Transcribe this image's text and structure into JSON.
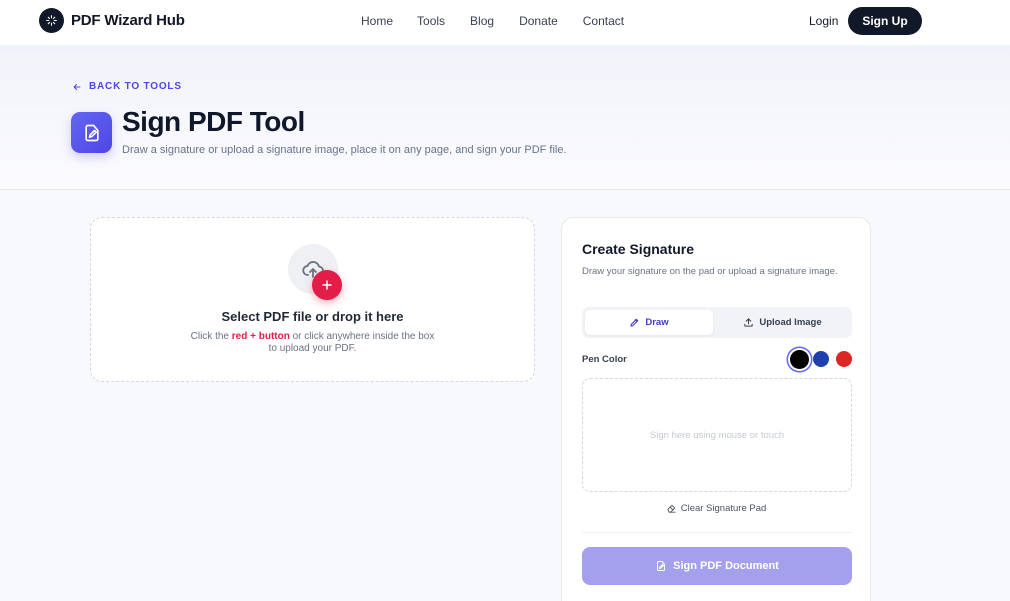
{
  "header": {
    "brand_name": "PDF Wizard Hub",
    "nav": [
      "Home",
      "Tools",
      "Blog",
      "Donate",
      "Contact"
    ],
    "login": "Login",
    "signup": "Sign Up"
  },
  "hero": {
    "back_label": "BACK TO TOOLS",
    "title": "Sign PDF Tool",
    "subtitle": "Draw a signature or upload a signature image, place it on any page, and sign your PDF file."
  },
  "dropzone": {
    "title": "Select PDF file or drop it here",
    "help_prefix": "Click the ",
    "help_highlight": "red + button",
    "help_suffix": " or click anywhere inside the box",
    "help_line2": "to upload your PDF.",
    "plus_symbol": "+"
  },
  "signature_panel": {
    "title": "Create Signature",
    "description": "Draw your signature on the pad or upload a signature image.",
    "tabs": {
      "draw": "Draw",
      "upload": "Upload Image"
    },
    "active_tab": "draw",
    "pen_color_label": "Pen Color",
    "pen_colors": [
      "#000000",
      "#1e40af",
      "#dc2626"
    ],
    "selected_pen_color": "#000000",
    "pad_placeholder": "Sign here using mouse or touch",
    "clear_label": "Clear Signature Pad",
    "sign_button": "Sign PDF Document"
  },
  "colors": {
    "accent": "#4f46e5",
    "plus_button": "#e11d48",
    "dark": "#111827",
    "sign_button_disabled": "#a5a0ee"
  }
}
